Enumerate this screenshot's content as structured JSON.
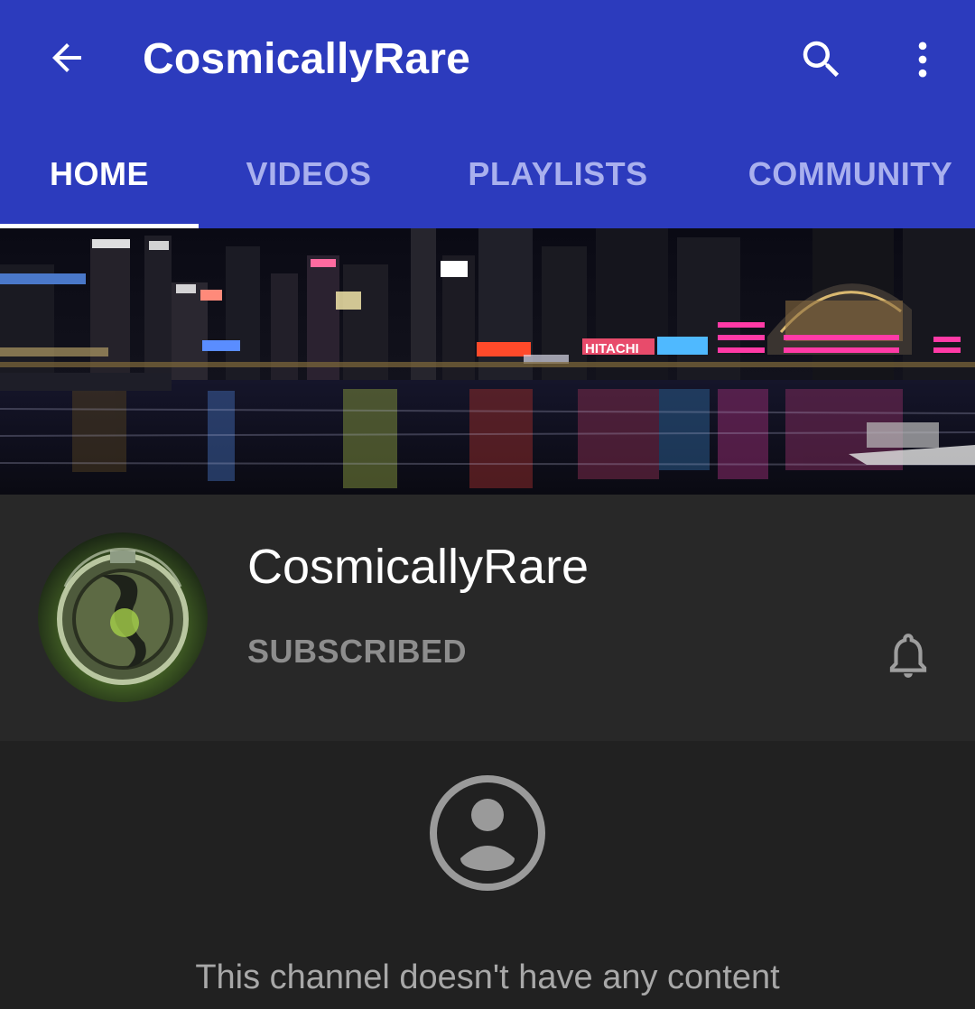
{
  "app_bar": {
    "back_icon": "arrow-back-icon",
    "title": "CosmicallyRare",
    "search_icon": "search-icon",
    "more_icon": "more-vert-icon",
    "background_color": "#2c3bbd"
  },
  "tabs": [
    {
      "label": "HOME",
      "active": true
    },
    {
      "label": "VIDEOS",
      "active": false
    },
    {
      "label": "PLAYLISTS",
      "active": false
    },
    {
      "label": "COMMUNITY",
      "active": false
    }
  ],
  "banner": {
    "description_icon": "city-night-skyline-image",
    "sign_text": "HITACHI"
  },
  "channel": {
    "name": "CosmicallyRare",
    "subscription_status": "SUBSCRIBED",
    "notification_icon": "bell-icon"
  },
  "content": {
    "empty_icon": "account-circle-icon",
    "empty_message": "This channel doesn't have any content"
  }
}
